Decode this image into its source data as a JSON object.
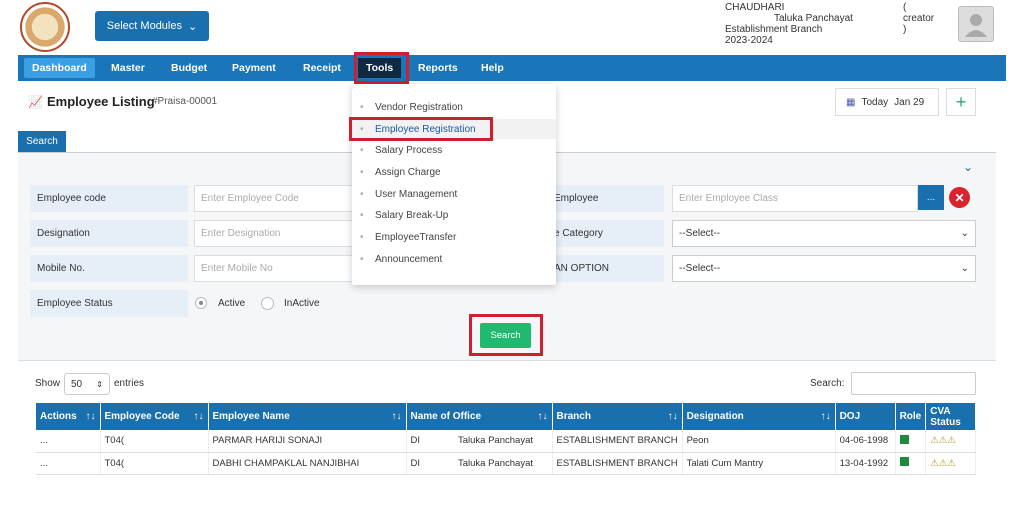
{
  "header": {
    "modules_label": "Select Modules",
    "user_name": "CHAUDHARI",
    "role": "( creator )",
    "office": "Taluka Panchayat",
    "branch": "Establishment Branch",
    "year": "2023-2024"
  },
  "nav": [
    "Dashboard",
    "Master",
    "Budget",
    "Payment",
    "Receipt",
    "Tools",
    "Reports",
    "Help"
  ],
  "page": {
    "title": "Employee Listing",
    "ref": "#Praisa-00001",
    "today_label": "Today",
    "today_date": "Jan 29",
    "search_tab": "Search",
    "search_button": "Search"
  },
  "tools_menu": [
    "Vendor Registration",
    "Employee Registration",
    "Salary Process",
    "Assign Charge",
    "User Management",
    "Salary Break-Up",
    "EmployeeTransfer",
    "Announcement"
  ],
  "form": {
    "employee_code_label": "Employee code",
    "employee_code_placeholder": "Enter Employee Code",
    "designation_label": "Designation",
    "designation_placeholder": "Enter Designation",
    "mobile_label": "Mobile No.",
    "mobile_placeholder": "Enter Mobile No",
    "status_label": "Employee Status",
    "status_active": "Active",
    "status_inactive": "InActive",
    "class_label": "Employee",
    "class_placeholder": "Enter Employee Class",
    "category_label": "e Category",
    "category_value": "--Select--",
    "option_label": "AN OPTION",
    "option_value": "--Select--",
    "ellipsis": "..."
  },
  "listing": {
    "show_label": "Show",
    "show_value": "50",
    "entries_label": "entries",
    "search_label": "Search:",
    "columns": [
      "Actions",
      "Employee Code",
      "Employee Name",
      "Name of Office",
      "Branch",
      "Designation",
      "DOJ",
      "Role",
      "CVA Status"
    ],
    "rows": [
      {
        "actions": "...",
        "code": "T04(",
        "name": "PARMAR HARIJI SONAJI",
        "office_a": "DI",
        "office_b": "Taluka Panchayat",
        "branch": "ESTABLISHMENT BRANCH",
        "designation": "Peon",
        "doj": "04-06-1998"
      },
      {
        "actions": "...",
        "code": "T04(",
        "name": "DABHI CHAMPAKLAL NANJIBHAI",
        "office_a": "DI",
        "office_b": "Taluka Panchayat",
        "branch": "ESTABLISHMENT BRANCH",
        "designation": "Talati Cum Mantry",
        "doj": "13-04-1992"
      }
    ]
  }
}
